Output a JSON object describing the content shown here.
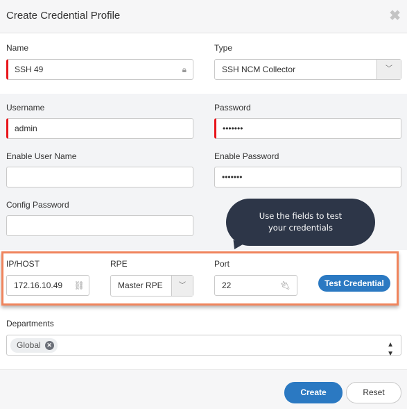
{
  "dialog": {
    "title": "Create Credential Profile"
  },
  "fields": {
    "name": {
      "label": "Name",
      "value": "SSH 49",
      "icon": "lock-icon"
    },
    "type": {
      "label": "Type",
      "value": "SSH NCM Collector"
    },
    "username": {
      "label": "Username",
      "value": "admin"
    },
    "password": {
      "label": "Password",
      "value": "•••••••"
    },
    "enable_user": {
      "label": "Enable User Name",
      "value": ""
    },
    "enable_password": {
      "label": "Enable Password",
      "value": "•••••••"
    },
    "config_password": {
      "label": "Config Password",
      "value": ""
    },
    "ip_host": {
      "label": "IP/HOST",
      "value": "172.16.10.49",
      "icon": "binoculars-icon"
    },
    "rpe": {
      "label": "RPE",
      "value": "Master RPE"
    },
    "port": {
      "label": "Port",
      "value": "22",
      "icon": "plug-icon"
    },
    "departments": {
      "label": "Departments",
      "tags": [
        "Global"
      ]
    }
  },
  "tooltip": {
    "line1": "Use the fields to test",
    "line2": "your credentials"
  },
  "buttons": {
    "test": "Test Credential",
    "create": "Create",
    "reset": "Reset"
  },
  "colors": {
    "accent": "#2b79c2",
    "required": "#e8141a",
    "highlight": "#f0845c",
    "tooltip": "#2d3648"
  }
}
